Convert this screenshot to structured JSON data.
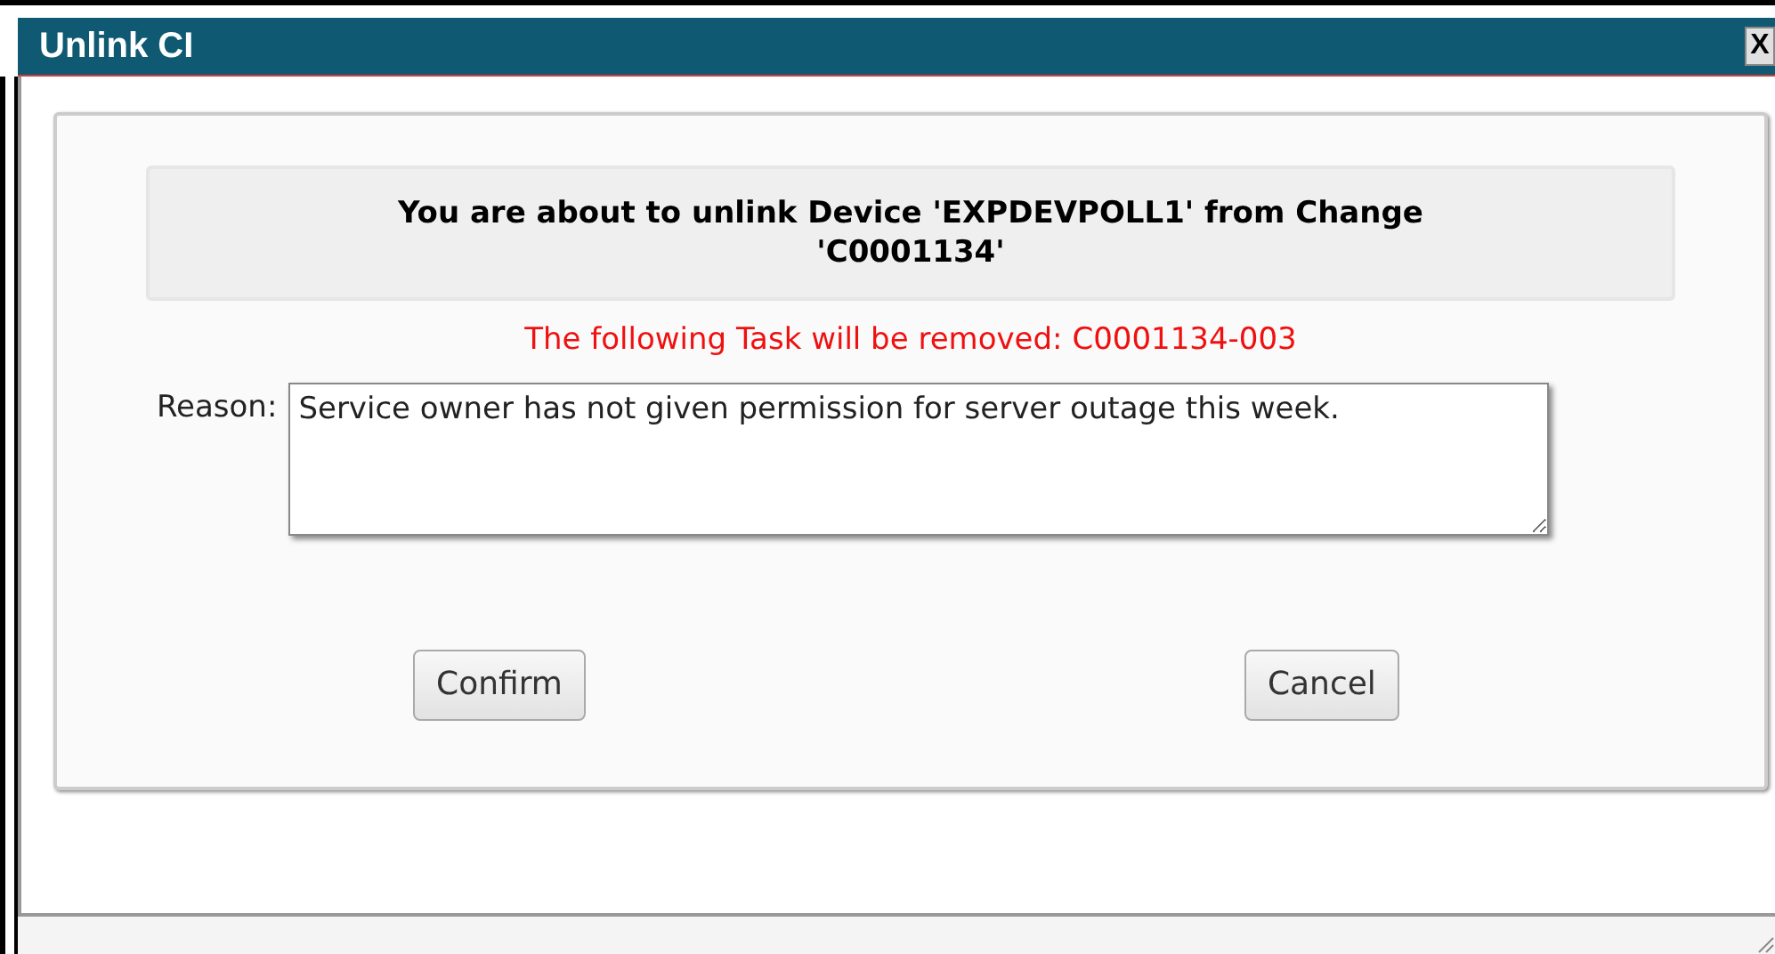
{
  "window": {
    "title": "Unlink CI",
    "close": "X"
  },
  "dialog": {
    "heading": "You are about to unlink Device 'EXPDEVPOLL1' from Change 'C0001134'",
    "warning": "The following Task will be removed: C0001134-003",
    "reason": {
      "label": "Reason:",
      "value": "Service owner has not given permission for server outage this week."
    },
    "buttons": [
      {
        "label": "Confirm"
      },
      {
        "label": "Cancel"
      }
    ]
  }
}
